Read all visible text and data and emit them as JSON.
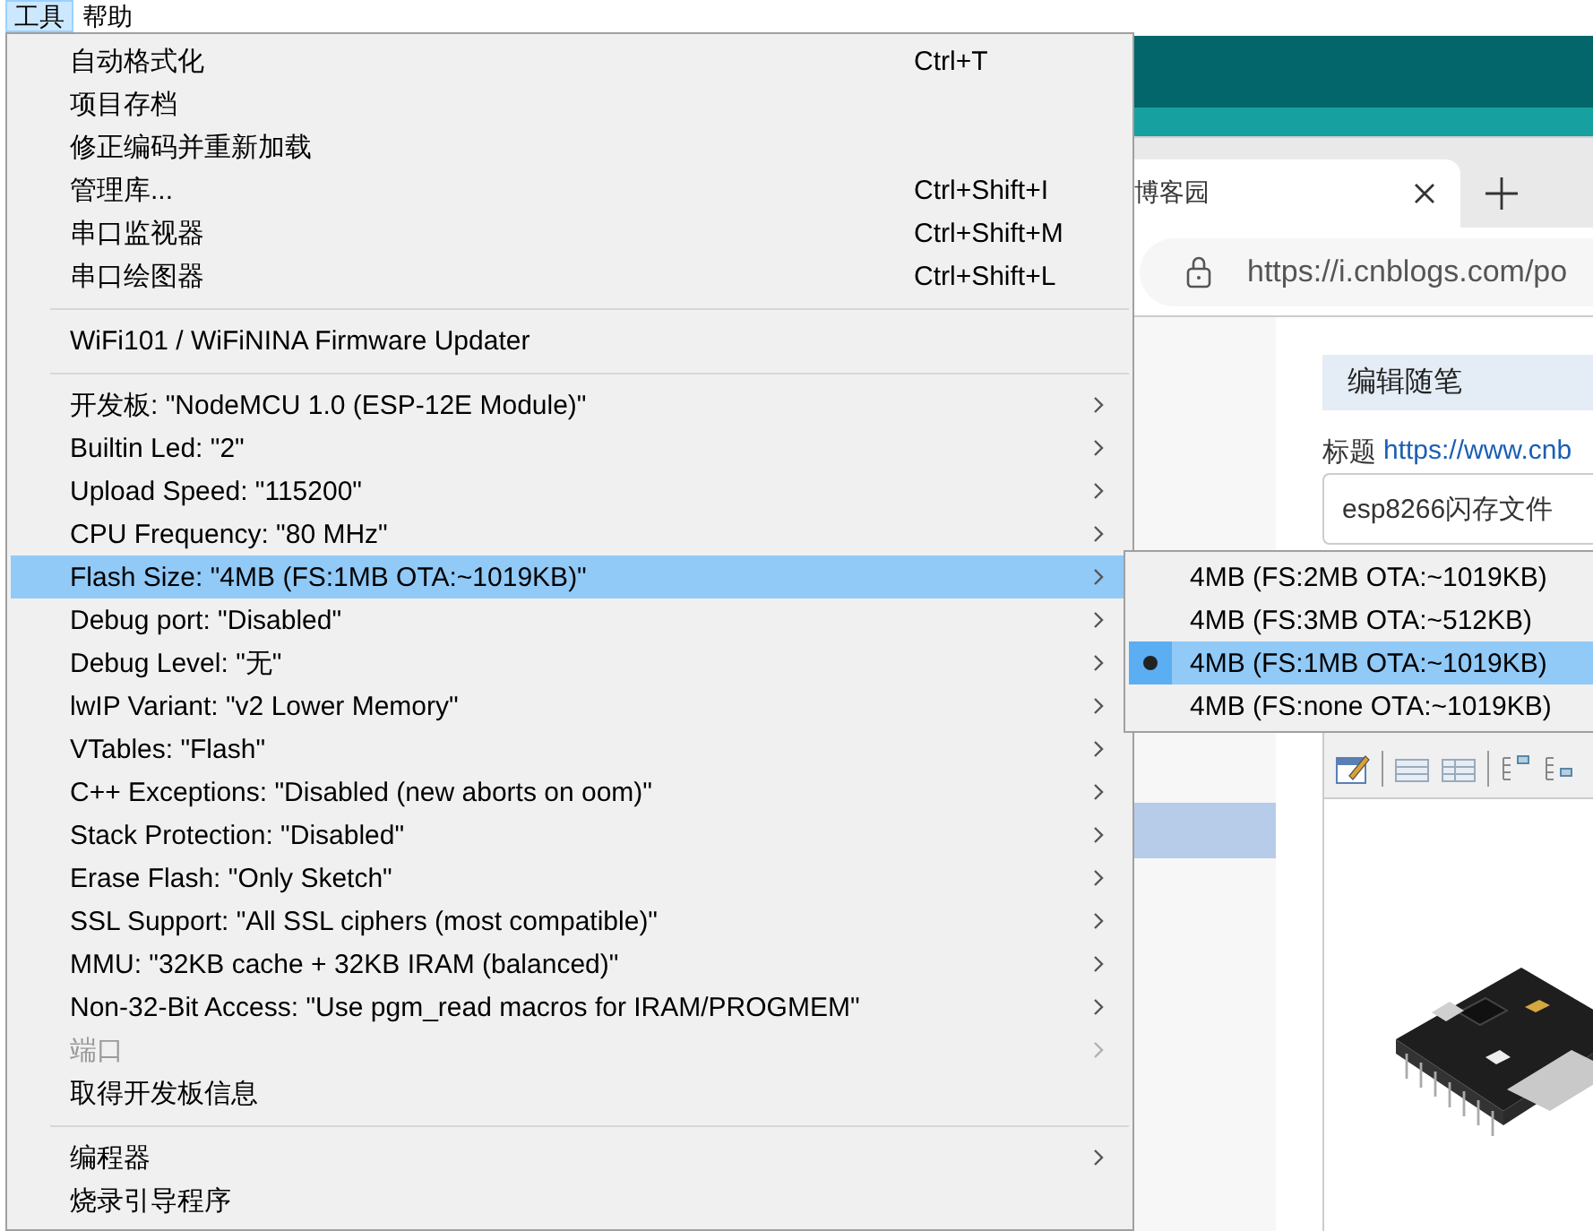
{
  "menubar": [
    {
      "label": "工具",
      "selected": true
    },
    {
      "label": "帮助",
      "selected": false
    }
  ],
  "menu": {
    "sections": [
      [
        {
          "label": "自动格式化",
          "shortcut": "Ctrl+T",
          "kind": "command",
          "selected": false,
          "disabled": false
        },
        {
          "label": "项目存档",
          "kind": "command",
          "selected": false,
          "disabled": false
        },
        {
          "label": "修正编码并重新加载",
          "kind": "command",
          "selected": false,
          "disabled": false
        },
        {
          "label": "管理库...",
          "shortcut": "Ctrl+Shift+I",
          "kind": "command",
          "selected": false,
          "disabled": false
        },
        {
          "label": "串口监视器",
          "shortcut": "Ctrl+Shift+M",
          "kind": "command",
          "selected": false,
          "disabled": false
        },
        {
          "label": "串口绘图器",
          "shortcut": "Ctrl+Shift+L",
          "kind": "command",
          "selected": false,
          "disabled": false
        }
      ],
      [
        {
          "label": "WiFi101 / WiFiNINA Firmware Updater",
          "kind": "command",
          "selected": false,
          "disabled": false
        }
      ],
      [
        {
          "label": "开发板: \"NodeMCU 1.0 (ESP-12E Module)\"",
          "kind": "submenu",
          "selected": false,
          "disabled": false
        },
        {
          "label": "Builtin Led: \"2\"",
          "kind": "submenu",
          "selected": false,
          "disabled": false
        },
        {
          "label": "Upload Speed: \"115200\"",
          "kind": "submenu",
          "selected": false,
          "disabled": false
        },
        {
          "label": "CPU Frequency: \"80 MHz\"",
          "kind": "submenu",
          "selected": false,
          "disabled": false
        },
        {
          "label": "Flash Size: \"4MB (FS:1MB OTA:~1019KB)\"",
          "kind": "submenu",
          "selected": true,
          "disabled": false
        },
        {
          "label": "Debug port: \"Disabled\"",
          "kind": "submenu",
          "selected": false,
          "disabled": false
        },
        {
          "label": "Debug Level: \"无\"",
          "kind": "submenu",
          "selected": false,
          "disabled": false
        },
        {
          "label": "lwIP Variant: \"v2 Lower Memory\"",
          "kind": "submenu",
          "selected": false,
          "disabled": false
        },
        {
          "label": "VTables: \"Flash\"",
          "kind": "submenu",
          "selected": false,
          "disabled": false
        },
        {
          "label": "C++ Exceptions: \"Disabled (new aborts on oom)\"",
          "kind": "submenu",
          "selected": false,
          "disabled": false
        },
        {
          "label": "Stack Protection: \"Disabled\"",
          "kind": "submenu",
          "selected": false,
          "disabled": false
        },
        {
          "label": "Erase Flash: \"Only Sketch\"",
          "kind": "submenu",
          "selected": false,
          "disabled": false
        },
        {
          "label": "SSL Support: \"All SSL ciphers (most compatible)\"",
          "kind": "submenu",
          "selected": false,
          "disabled": false
        },
        {
          "label": "MMU: \"32KB cache + 32KB IRAM (balanced)\"",
          "kind": "submenu",
          "selected": false,
          "disabled": false
        },
        {
          "label": "Non-32-Bit Access: \"Use pgm_read macros for IRAM/PROGMEM\"",
          "kind": "submenu",
          "selected": false,
          "disabled": false
        },
        {
          "label": "端口",
          "kind": "submenu",
          "selected": false,
          "disabled": true
        },
        {
          "label": "取得开发板信息",
          "kind": "command",
          "selected": false,
          "disabled": false
        }
      ],
      [
        {
          "label": "编程器",
          "kind": "submenu",
          "selected": false,
          "disabled": false
        },
        {
          "label": "烧录引导程序",
          "kind": "command",
          "selected": false,
          "disabled": false
        }
      ]
    ]
  },
  "submenu": {
    "items": [
      {
        "label": "4MB (FS:2MB OTA:~1019KB)",
        "checked": false,
        "selected": false
      },
      {
        "label": "4MB (FS:3MB OTA:~512KB)",
        "checked": false,
        "selected": false
      },
      {
        "label": "4MB (FS:1MB OTA:~1019KB)",
        "checked": true,
        "selected": true
      },
      {
        "label": "4MB (FS:none OTA:~1019KB)",
        "checked": false,
        "selected": false
      }
    ]
  },
  "browser": {
    "tab_title": "博客园",
    "address": "https://i.cnblogs.com/po",
    "heading": "编辑随笔",
    "title_label": "标题",
    "title_link": "https://www.cnb",
    "title_value": "esp8266闪存文件"
  }
}
